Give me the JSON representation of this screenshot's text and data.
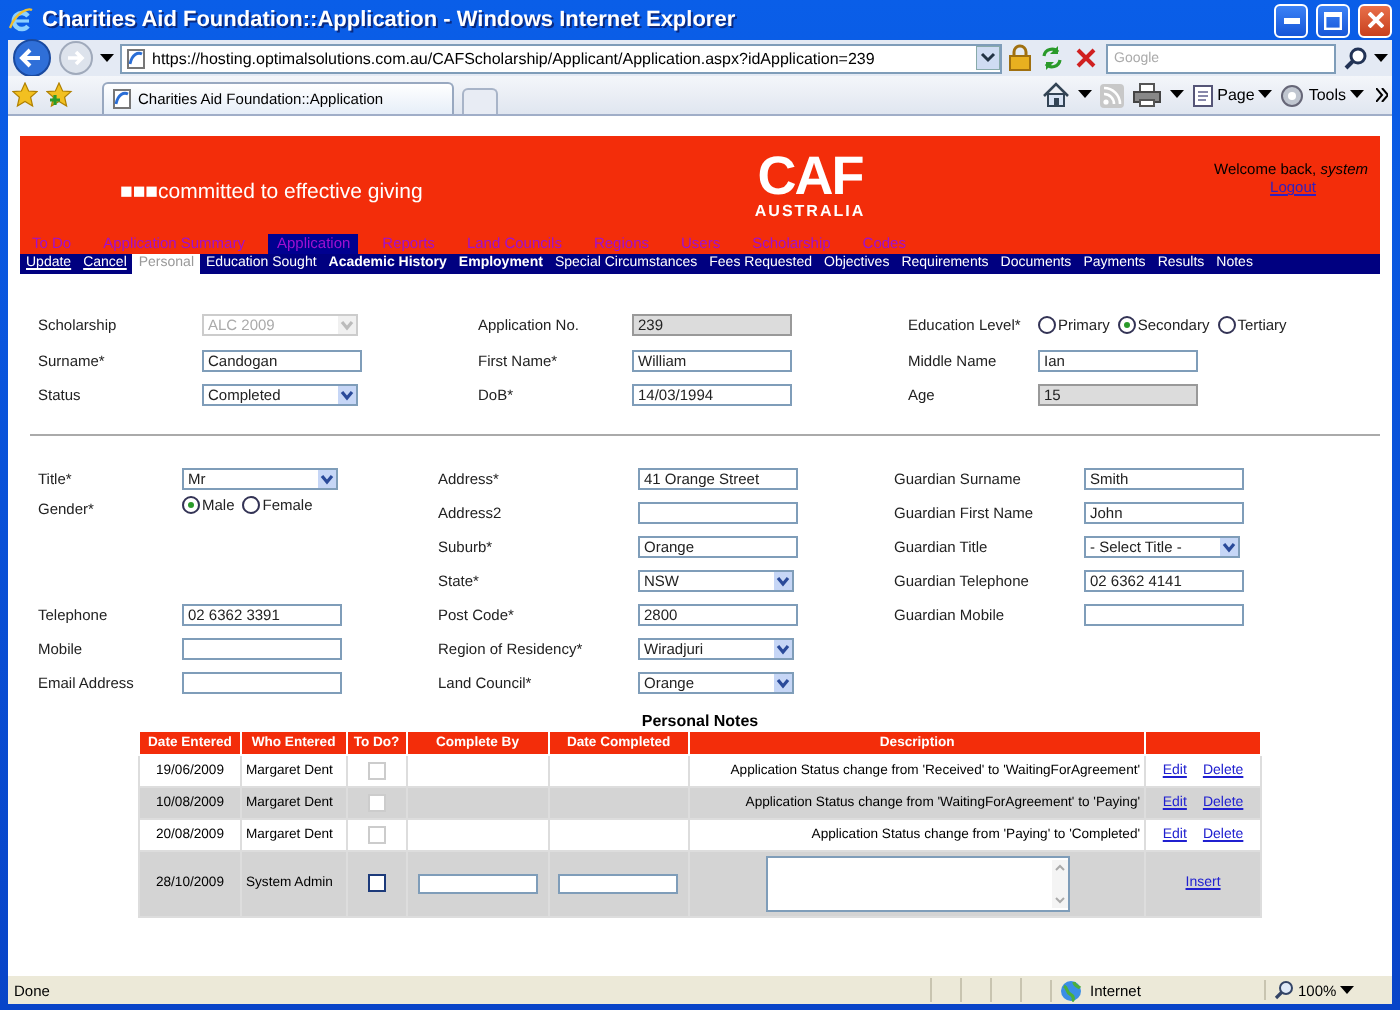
{
  "window": {
    "title": "Charities Aid Foundation::Application - Windows Internet Explorer"
  },
  "browser": {
    "url": "https://hosting.optimalsolutions.com.au/CAFScholarship/Applicant/Application.aspx?idApplication=239",
    "search_placeholder": "Google",
    "tab": "Charities Aid Foundation::Application",
    "tools": [
      "Page",
      "Tools"
    ]
  },
  "header": {
    "tagline": "■■■committed to effective giving",
    "logo": "CAF",
    "logo_subtitle": "AUSTRALIA",
    "welcome": "Welcome back, *system*",
    "logout": "Logout"
  },
  "menu": [
    {
      "label": "To Do",
      "selected": false
    },
    {
      "label": "Application Summary",
      "selected": false
    },
    {
      "label": "Application",
      "selected": true
    },
    {
      "label": "Reports",
      "selected": false
    },
    {
      "label": "Land Councils",
      "selected": false
    },
    {
      "label": "Regions",
      "selected": false
    },
    {
      "label": "Users",
      "selected": false
    },
    {
      "label": "Scholarship",
      "selected": false
    },
    {
      "label": "Codes",
      "selected": false
    }
  ],
  "submenu": [
    {
      "label": "Update",
      "kind": "action",
      "selected": false,
      "bold": false
    },
    {
      "label": "Cancel",
      "kind": "action",
      "selected": false,
      "bold": false
    },
    {
      "label": "Personal",
      "kind": "tab",
      "selected": true,
      "bold": false
    },
    {
      "label": "Education Sought",
      "kind": "tab",
      "selected": false,
      "bold": false
    },
    {
      "label": "Academic History",
      "kind": "tab",
      "selected": false,
      "bold": true
    },
    {
      "label": "Employment",
      "kind": "tab",
      "selected": false,
      "bold": true
    },
    {
      "label": "Special Circumstances",
      "kind": "tab",
      "selected": false,
      "bold": false
    },
    {
      "label": "Fees Requested",
      "kind": "tab",
      "selected": false,
      "bold": false
    },
    {
      "label": "Objectives",
      "kind": "tab",
      "selected": false,
      "bold": false
    },
    {
      "label": "Requirements",
      "kind": "tab",
      "selected": false,
      "bold": false
    },
    {
      "label": "Documents",
      "kind": "tab",
      "selected": false,
      "bold": false
    },
    {
      "label": "Payments",
      "kind": "tab",
      "selected": false,
      "bold": false
    },
    {
      "label": "Results",
      "kind": "tab",
      "selected": false,
      "bold": false
    },
    {
      "label": "Notes",
      "kind": "tab",
      "selected": false,
      "bold": false
    }
  ],
  "sections": [
    {
      "rows": [
        [
          {
            "label": "Scholarship",
            "kind": "select",
            "value": "ALC 2009",
            "disabled": true
          },
          {
            "label": "Application No.",
            "kind": "text",
            "value": "239",
            "readonly": true
          },
          {
            "label": "Education Level*",
            "kind": "radio",
            "options": [
              {
                "label": "Primary",
                "selected": false
              },
              {
                "label": "Secondary",
                "selected": true
              },
              {
                "label": "Tertiary",
                "selected": false
              }
            ]
          }
        ],
        [
          {
            "label": "Surname*",
            "kind": "text",
            "value": "Candogan",
            "readonly": false
          },
          {
            "label": "First Name*",
            "kind": "text",
            "value": "William",
            "readonly": false
          },
          {
            "label": "Middle Name",
            "kind": "text",
            "value": "Ian",
            "readonly": false
          }
        ],
        [
          {
            "label": "Status",
            "kind": "select",
            "value": "Completed",
            "disabled": false
          },
          {
            "label": "DoB*",
            "kind": "text",
            "value": "14/03/1994",
            "readonly": false
          },
          {
            "label": "Age",
            "kind": "text",
            "value": "15",
            "readonly": true
          }
        ]
      ]
    },
    {
      "rows": [
        [
          {
            "label": "Title*",
            "kind": "select",
            "value": "Mr",
            "disabled": false
          },
          {
            "label": "Address*",
            "kind": "text",
            "value": "41 Orange Street",
            "readonly": false
          },
          {
            "label": "Guardian Surname",
            "kind": "text",
            "value": "Smith",
            "readonly": false
          }
        ],
        [
          {
            "label": "Gender*",
            "kind": "radio",
            "options": [
              {
                "label": "Male",
                "selected": true
              },
              {
                "label": "Female",
                "selected": false
              }
            ]
          },
          {
            "label": "Address2",
            "kind": "text",
            "readonly": false
          },
          {
            "label": "Guardian First Name",
            "kind": "text",
            "value": "John",
            "readonly": false
          }
        ],
        [
          {
            "kind": "blank"
          },
          {
            "label": "Suburb*",
            "kind": "text",
            "value": "Orange",
            "readonly": false
          },
          {
            "label": "Guardian Title",
            "kind": "select",
            "value": "- Select Title -",
            "disabled": false
          }
        ],
        [
          {
            "kind": "blank"
          },
          {
            "label": "State*",
            "kind": "select",
            "value": "NSW",
            "disabled": false
          },
          {
            "label": "Guardian Telephone",
            "kind": "text",
            "value": "02 6362 4141",
            "readonly": false
          }
        ],
        [
          {
            "label": "Telephone",
            "kind": "text",
            "value": "02 6362 3391",
            "readonly": false
          },
          {
            "label": "Post Code*",
            "kind": "text",
            "value": "2800",
            "readonly": false
          },
          {
            "label": "Guardian Mobile",
            "kind": "text",
            "readonly": false
          }
        ],
        [
          {
            "label": "Mobile",
            "kind": "text",
            "readonly": false
          },
          {
            "label": "Region of Residency*",
            "kind": "select",
            "value": "Wiradjuri",
            "disabled": false
          },
          {
            "kind": "blank"
          }
        ],
        [
          {
            "label": "Email Address",
            "kind": "text",
            "readonly": false
          },
          {
            "label": "Land Council*",
            "kind": "select",
            "value": "Orange",
            "disabled": false
          },
          {
            "kind": "blank"
          }
        ]
      ]
    }
  ],
  "notes": {
    "title": "Personal Notes",
    "columns": [
      "Date Entered",
      "Who Entered",
      "To Do?",
      "Complete By",
      "Date Completed",
      "Description"
    ],
    "rows": [
      {
        "kind": "note",
        "date_entered": "19/06/2009",
        "who_entered": "Margaret Dent",
        "to_do": false,
        "description": "Application Status change from 'Received' to 'WaitingForAgreement'",
        "actions": [
          "Edit",
          "Delete"
        ]
      },
      {
        "kind": "note",
        "date_entered": "10/08/2009",
        "who_entered": "Margaret Dent",
        "to_do": false,
        "description": "Application Status change from 'WaitingForAgreement' to 'Paying'",
        "actions": [
          "Edit",
          "Delete"
        ]
      },
      {
        "kind": "note",
        "date_entered": "20/08/2009",
        "who_entered": "Margaret Dent",
        "to_do": false,
        "description": "Application Status change from 'Paying' to 'Completed'",
        "actions": [
          "Edit",
          "Delete"
        ]
      },
      {
        "kind": "new",
        "date_entered": "28/10/2009",
        "who_entered": "System Admin",
        "to_do": false,
        "actions": [
          "Insert"
        ]
      }
    ]
  },
  "status_bar": {
    "text": "Done",
    "zone": "Internet",
    "zoom": "100%"
  }
}
